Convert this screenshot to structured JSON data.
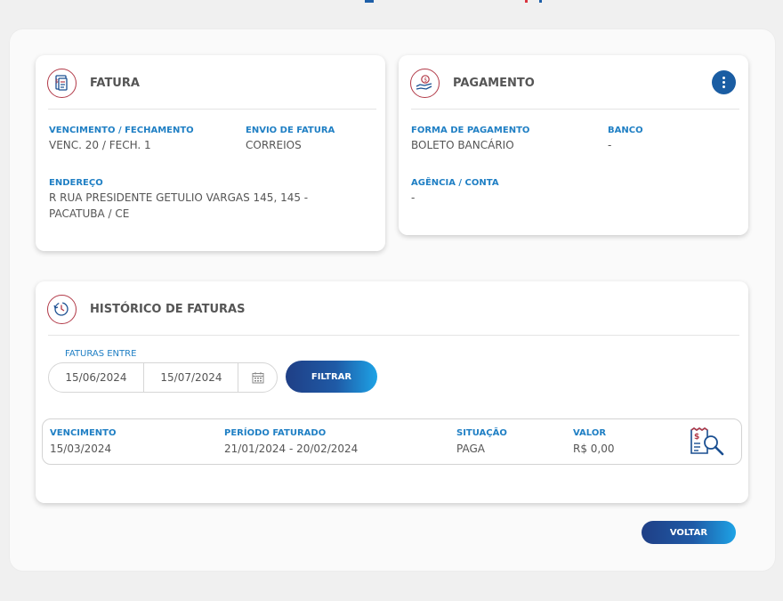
{
  "fatura": {
    "title": "FATURA",
    "icon": "invoice-icon",
    "vencimento_label": "VENCIMENTO / FECHAMENTO",
    "vencimento_value": "VENC. 20 / FECH. 1",
    "envio_label": "ENVIO DE FATURA",
    "envio_value": "CORREIOS",
    "endereco_label": "ENDEREÇO",
    "endereco_value": "R RUA PRESIDENTE GETULIO VARGAS 145, 145 - PACATUBA / CE"
  },
  "pagamento": {
    "title": "PAGAMENTO",
    "icon": "payment-hand-icon",
    "more_icon": "more-vertical-icon",
    "forma_label": "FORMA DE PAGAMENTO",
    "forma_value": "BOLETO BANCÁRIO",
    "banco_label": "BANCO",
    "banco_value": "-",
    "agencia_label": "AGÊNCIA / CONTA",
    "agencia_value": "-"
  },
  "historico": {
    "title": "HISTÓRICO DE FATURAS",
    "icon": "history-clock-icon",
    "filter_label": "FATURAS ENTRE",
    "date_from": "15/06/2024",
    "date_to": "15/07/2024",
    "calendar_icon": "calendar-icon",
    "filter_button": "FILTRAR",
    "columns": {
      "vencimento": "VENCIMENTO",
      "periodo": "PERÍODO FATURADO",
      "situacao": "SITUAÇÃO",
      "valor": "VALOR"
    },
    "rows": [
      {
        "vencimento": "15/03/2024",
        "periodo": "21/01/2024 - 20/02/2024",
        "situacao": "PAGA",
        "valor": "R$ 0,00",
        "action_icon": "invoice-search-icon"
      }
    ]
  },
  "back_button": "VOLTAR",
  "colors": {
    "accent_blue": "#1f7fc4",
    "button_dark": "#1f3f86",
    "button_light": "#1ea3e6",
    "icon_red": "#b23a48"
  }
}
